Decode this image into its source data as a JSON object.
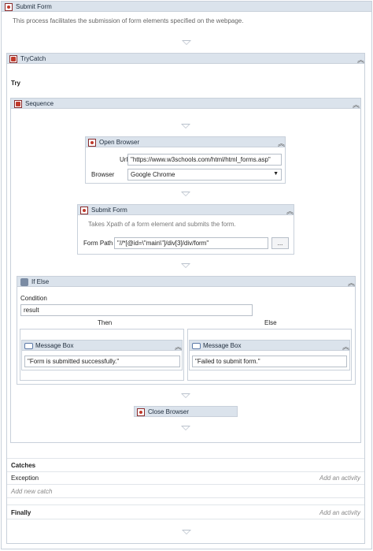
{
  "root": {
    "title": "Submit Form",
    "description": "This process facilitates the submission of form elements specified on the webpage."
  },
  "trycatch": {
    "title": "TryCatch",
    "try_label": "Try",
    "catches_label": "Catches",
    "exception_label": "Exception",
    "add_activity": "Add an activity",
    "add_new_catch": "Add new catch",
    "finally_label": "Finally",
    "finally_add_activity": "Add an activity"
  },
  "sequence": {
    "title": "Sequence"
  },
  "open_browser": {
    "title": "Open Browser",
    "url_label": "Url",
    "url_value": "\"https://www.w3schools.com/html/html_forms.asp\"",
    "browser_label": "Browser",
    "browser_value": "Google Chrome"
  },
  "submit_form": {
    "title": "Submit Form",
    "description": "Takes Xpath of a form element and submits the form.",
    "form_path_label": "Form Path",
    "form_path_value": "\"//*[@id=\\\"main\\\"]/div[3]/div/form\"",
    "browse_label": "..."
  },
  "if_else": {
    "title": "If Else",
    "condition_label": "Condition",
    "condition_value": "result",
    "then_label": "Then",
    "else_label": "Else",
    "then_message": {
      "title": "Message Box",
      "value": "\"Form is submitted successfully.\""
    },
    "else_message": {
      "title": "Message Box",
      "value": "\"Failed to submit form.\""
    }
  },
  "close_browser": {
    "title": "Close Browser"
  },
  "icons": {
    "collapse": "double-chevron-up-icon",
    "flow_arrow": "flow-arrow-down-icon",
    "dropdown": "chevron-down-icon"
  },
  "colors": {
    "header_bg": "#dbe3ec",
    "border": "#c8d0da",
    "activity_icon": "#c0392b"
  }
}
